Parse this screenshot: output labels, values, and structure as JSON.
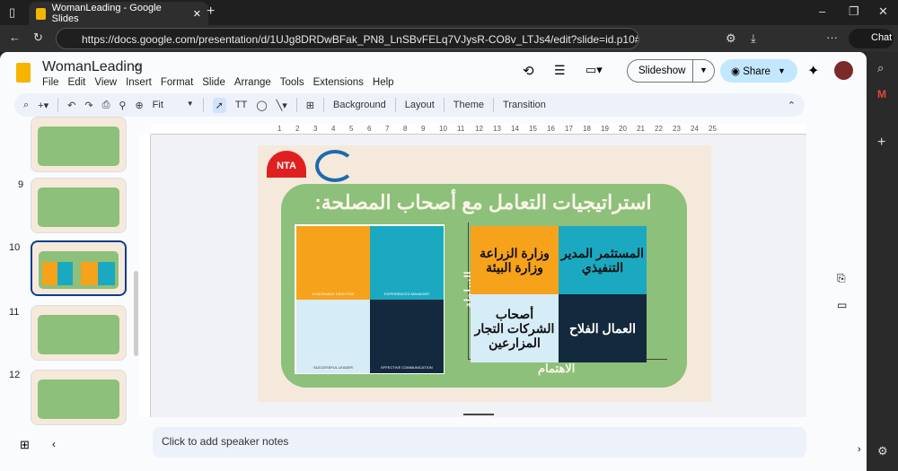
{
  "browser": {
    "tab_title": "WomanLeading - Google Slides",
    "url": "https://docs.google.com/presentation/d/1UJg8DRDwBFak_PN8_LnSBvFELq7VJysR-CO8v_LTJs4/edit?slide=id.p10#slide=id...",
    "chat_label": "Chat"
  },
  "app": {
    "doc_title": "WomanLeading",
    "menu": [
      "File",
      "Edit",
      "View",
      "Insert",
      "Format",
      "Slide",
      "Arrange",
      "Tools",
      "Extensions",
      "Help"
    ],
    "slideshow_label": "Slideshow",
    "share_label": "Share"
  },
  "toolbar": {
    "zoom": "Fit",
    "background": "Background",
    "layout": "Layout",
    "theme": "Theme",
    "transition": "Transition"
  },
  "filmstrip": {
    "numbers": [
      "9",
      "10",
      "11",
      "12"
    ]
  },
  "ruler": [
    "1",
    "2",
    "3",
    "4",
    "5",
    "6",
    "7",
    "8",
    "9",
    "10",
    "11",
    "12",
    "13",
    "14",
    "15",
    "16",
    "17",
    "18",
    "19",
    "20",
    "21",
    "22",
    "23",
    "24",
    "25"
  ],
  "slide": {
    "logo_text": "NTA",
    "title": "استراتيجيات التعامل مع أصحاب المصلحة:",
    "images": [
      "HONORABLE DIRECTOR",
      "EXPERIENCED MANAGER",
      "SUCCESSFUL LEADER",
      "EFFECTIVE COMMUNICATION"
    ],
    "quadrants": {
      "top_left": "وزارة الزراعة وزارة البيئة",
      "top_right": "المستثمر المدير التنفيذي",
      "bottom_left": "أصحاب الشركات التجار المزارعين",
      "bottom_right": "العمال الفلاح"
    },
    "y_axis": "السلطة",
    "x_axis": "الاهتمام",
    "colors": {
      "orange": "#f7a21b",
      "teal": "#1ba9c1",
      "light": "#d6ecf7",
      "navy": "#13293d",
      "green": "#8dc07a"
    }
  },
  "notes": {
    "placeholder": "Click to add speaker notes"
  }
}
